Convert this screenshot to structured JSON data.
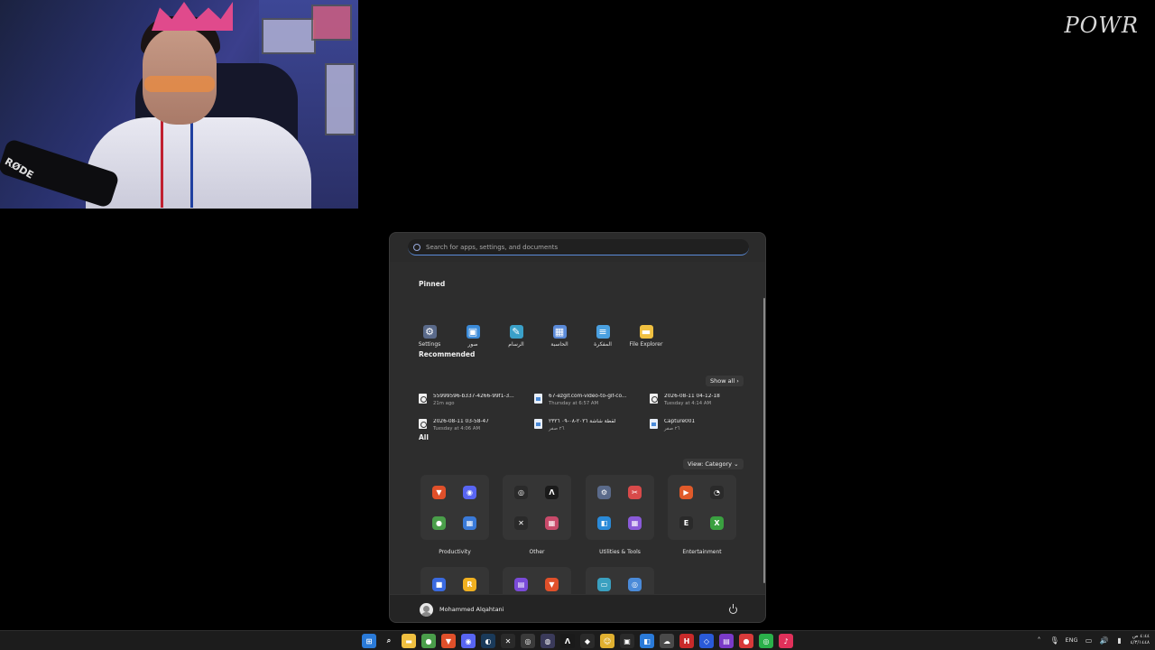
{
  "watermark": "POWR",
  "start_menu": {
    "search_placeholder": "Search for apps, settings, and documents",
    "pinned_title": "Pinned",
    "pinned": [
      {
        "label": "Settings",
        "icon": "gear-icon",
        "color": "#5a6a8a"
      },
      {
        "label": "صور",
        "icon": "photos-icon",
        "color": "#3a8ad8"
      },
      {
        "label": "الرسام",
        "icon": "paint-icon",
        "color": "#3aa0c8"
      },
      {
        "label": "الحاسبة",
        "icon": "calculator-icon",
        "color": "#5a8ad8"
      },
      {
        "label": "المفكرة",
        "icon": "notepad-icon",
        "color": "#4aa0e0"
      },
      {
        "label": "File Explorer",
        "icon": "folder-icon",
        "color": "#f0c040"
      }
    ],
    "recommended_title": "Recommended",
    "show_all": "Show all",
    "recommended": [
      {
        "name": "55999596-b337-4266-99f1-3...",
        "time": "21m ago",
        "type": "video"
      },
      {
        "name": "67-ezgif.com-video-to-gif-co...",
        "time": "Thursday at 6:57 AM",
        "type": "image"
      },
      {
        "name": "2026-08-11 04-12-18",
        "time": "Tuesday at 4:14 AM",
        "type": "video"
      },
      {
        "name": "2026-08-11 03-58-47",
        "time": "Tuesday at 4:06 AM",
        "type": "video"
      },
      {
        "name": "لقطة شاشة ٢٠٢٦-٠٨-٠٩ ٢٣٢٦",
        "time": "٢٦ صفر",
        "type": "image"
      },
      {
        "name": "Capture001",
        "time": "٢٦ صفر",
        "type": "image"
      }
    ],
    "all_title": "All",
    "view_category": "View: Category",
    "categories": [
      {
        "label": "Productivity"
      },
      {
        "label": "Other"
      },
      {
        "label": "Utilities & Tools"
      },
      {
        "label": "Entertainment"
      },
      {
        "label": ""
      },
      {
        "label": ""
      },
      {
        "label": ""
      }
    ],
    "user_name": "Mohammed Alqahtani"
  },
  "tray": {
    "lang": "ENG",
    "time": "٤:٤٤ ص",
    "date": "٤/٣/١٤٤٨"
  }
}
